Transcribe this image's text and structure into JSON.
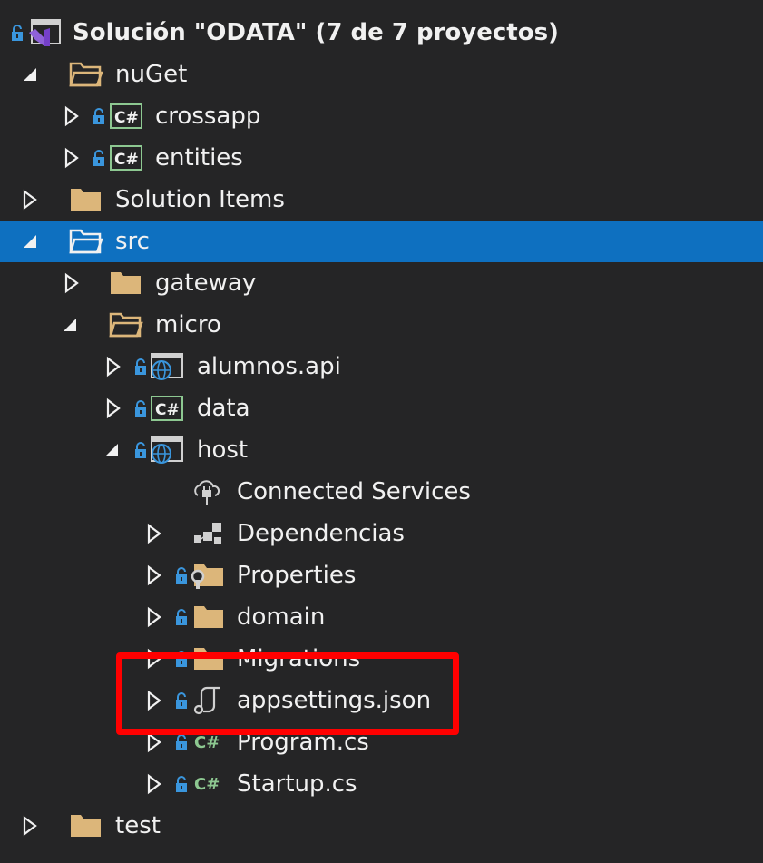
{
  "tree": {
    "solution_label": "Solución \"ODATA\" (7 de 7 proyectos)",
    "items": [
      {
        "label": "nuGet"
      },
      {
        "label": "crossapp",
        "badge": "C#"
      },
      {
        "label": "entities",
        "badge": "C#"
      },
      {
        "label": "Solution Items"
      },
      {
        "label": "src"
      },
      {
        "label": "gateway"
      },
      {
        "label": "micro"
      },
      {
        "label": "alumnos.api"
      },
      {
        "label": "data",
        "badge": "C#"
      },
      {
        "label": "host"
      },
      {
        "label": "Connected Services"
      },
      {
        "label": "Dependencias"
      },
      {
        "label": "Properties"
      },
      {
        "label": "domain"
      },
      {
        "label": "Migrations"
      },
      {
        "label": "appsettings.json"
      },
      {
        "label": "Program.cs",
        "badge": "C#"
      },
      {
        "label": "Startup.cs",
        "badge": "C#"
      },
      {
        "label": "test"
      }
    ]
  },
  "colors": {
    "background": "#252526",
    "selection": "#0e70c0",
    "folder": "#dcb67a",
    "lock": "#3a96dd",
    "csharp": "#8dc891",
    "highlight": "#ff0000"
  }
}
